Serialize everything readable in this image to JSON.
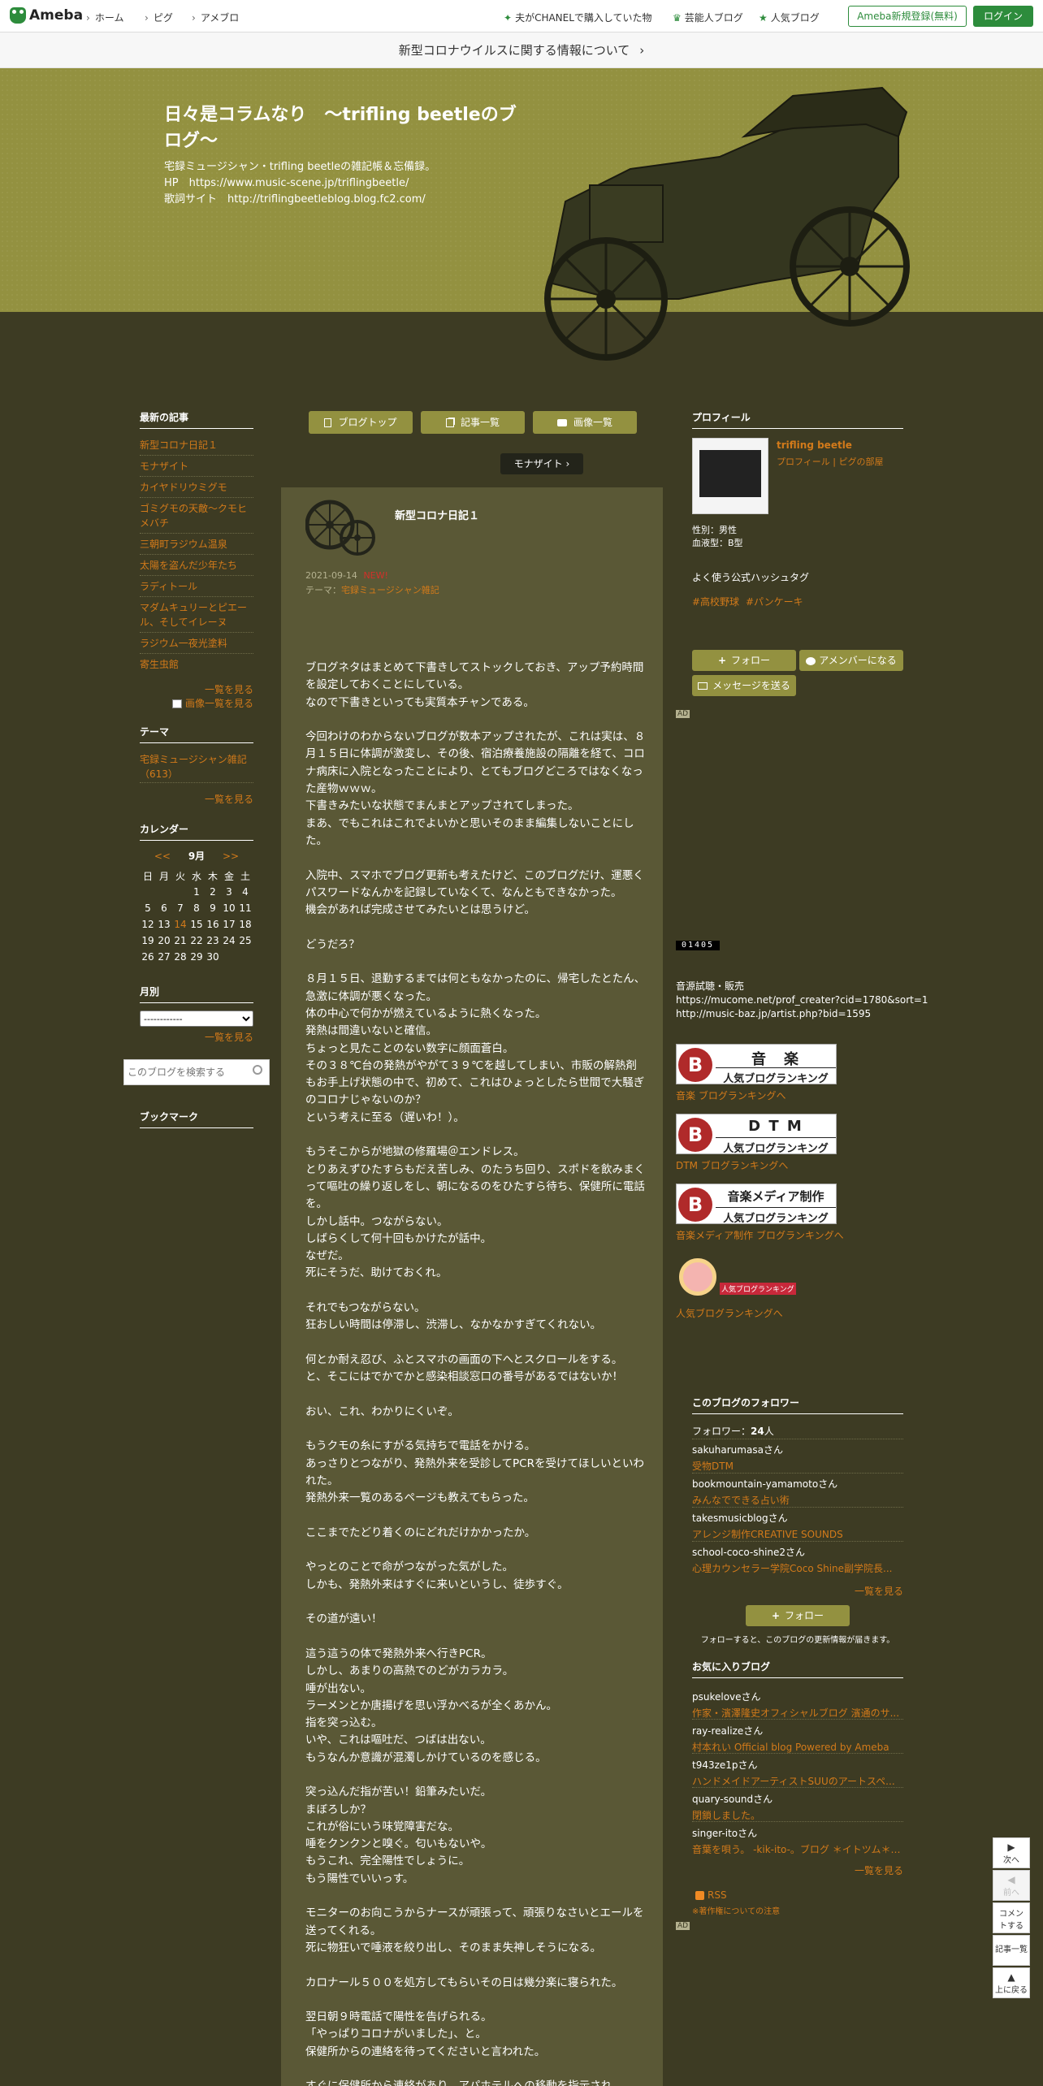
{
  "topbar": {
    "logo": "Ameba",
    "nav": [
      "ホーム",
      "ピグ",
      "アメブロ"
    ],
    "links": [
      "夫がCHANELで購入していた物",
      "芸能人ブログ",
      "人気ブログ"
    ],
    "register": "Ameba新規登録(無料)",
    "login": "ログイン"
  },
  "notice": "新型コロナウイルスに関する情報について",
  "blog": {
    "title": "日々是コラムなり　～trifling beetleのブログ～",
    "description": "宅録ミュージシャン・trifling beetleの雑記帳＆忘備録。\nHP　https://www.music-scene.jp/triflingbeetle/\n歌詞サイト　http://triflingbeetleblog.blog.fc2.com/"
  },
  "tabs": {
    "top": "ブログトップ",
    "list": "記事一覧",
    "images": "画像一覧"
  },
  "next_post": "モナザイト",
  "post": {
    "title": "新型コロナ日記１",
    "date": "2021-09-14",
    "badge": "NEW!",
    "theme_label": "テーマ：",
    "theme": "宅録ミュージシャン雑記",
    "body": "ブログネタはまとめて下書きしてストックしておき、アップ予約時間を設定しておくことにしている。\nなので下書きといっても実質本チャンである。\n\n今回わけのわからないブログが数本アップされたが、これは実は、８月１５日に体調が激変し、その後、宿泊療養施設の隔離を経て、コロナ病床に入院となったことにより、とてもブログどころではなくなった産物ｗｗｗ。\n下書きみたいな状態でまんまとアップされてしまった。\nまあ、でもこれはこれでよいかと思いそのまま編集しないことにした。\n\n入院中、スマホでブログ更新も考えたけど、このブログだけ、運悪くパスワードなんかを記録していなくて、なんともできなかった。\n機会があれば完成させてみたいとは思うけど。\n\nどうだろ？\n\n８月１５日、退勤するまでは何ともなかったのに、帰宅したとたん、急激に体調が悪くなった。\n体の中心で何かが燃えているように熱くなった。\n発熱は間違いないと確信。\nちょっと見たことのない数字に顔面蒼白。\nその３８℃台の発熱がやがて３９℃を越してしまい、市販の解熱剤もお手上げ状態の中で、初めて、これはひょっとしたら世間で大騒ぎのコロナじゃないのか？\nという考えに至る（遅いわ！）。\n\nもうそこからが地獄の修羅場＠エンドレス。\nとりあえずひたすらもだえ苦しみ、のたうち回り、スポドを飲みまくって嘔吐の繰り返しをし、朝になるのをひたすら待ち、保健所に電話を。\nしかし話中。つながらない。\nしばらくして何十回もかけたが話中。\nなぜだ。\n死にそうだ、助けておくれ。\n\nそれでもつながらない。\n狂おしい時間は停滞し、渋滞し、なかなかすぎてくれない。\n\n何とか耐え忍び、ふとスマホの画面の下へとスクロールをする。\nと、そこにはでかでかと感染相談窓口の番号があるではないか！\n\nおい、これ、わかりにくいぞ。\n\nもうクモの糸にすがる気持ちで電話をかける。\nあっさりとつながり、発熱外来を受診してPCRを受けてほしいといわれた。\n発熱外来一覧のあるページも教えてもらった。\n\nここまでたどり着くのにどれだけかかったか。\n\nやっとのことで命がつながった気がした。\nしかも、発熱外来はすぐに来いというし、徒歩すぐ。\n\nその道が遠い！\n\n這う這うの体で発熱外来へ行きPCR。\nしかし、あまりの高熱でのどがカラカラ。\n唾が出ない。\nラーメンとか唐揚げを思い浮かべるが全くあかん。\n指を突っ込む。\nいや、これは嘔吐だ、つばは出ない。\nもうなんか意識が混濁しかけているのを感じる。\n\n突っ込んだ指が苦い！鉛筆みたいだ。\nまぼろしか？\nこれが俗にいう味覚障害だな。\n唾をクンクンと嗅ぐ。匂いもないや。\nもうこれ、完全陽性でしょうに。\nもう陽性でいいっす。\n\nモニターのお向こうからナースが頑張って、頑張りなさいとエールを送ってくれる。\n死に物狂いで唾液を絞り出し、そのまま失神しそうになる。\n\nカロナール５００を処方してもらいその日は幾分楽に寝られた。\n\n翌日朝９時電話で陽性を告げられる。\n「やっぱりコロナがいました」、と。\n保健所からの連絡を待ってくださいと言われた。\n\nすぐに保健所から連絡があり、アパホテルへの移動を指示され"
  },
  "sidebar": {
    "recent_title": "最新の記事",
    "recent": [
      "新型コロナ日記１",
      "モナザイト",
      "カイヤドリウミグモ",
      "ゴミグモの天敵～クモヒメバチ",
      "三朝町ラジウム温泉",
      "太陽を盗んだ少年たち",
      "ラディトール",
      "マダムキュリーとピエール、そしてイレーヌ",
      "ラジウム一夜光塗料",
      "寄生虫館"
    ],
    "more": "一覧を見る",
    "images_more": "画像一覧を見る",
    "theme_title": "テーマ",
    "theme_item": "宅録ミュージシャン雑記（613）",
    "calendar_title": "カレンダー",
    "cal_prev": "<<",
    "cal_month": "9月",
    "cal_next": ">>",
    "weekdays": [
      "日",
      "月",
      "火",
      "水",
      "木",
      "金",
      "土"
    ],
    "weeks": [
      [
        "",
        "",
        "",
        "1",
        "2",
        "3",
        "4"
      ],
      [
        "5",
        "6",
        "7",
        "8",
        "9",
        "10",
        "11"
      ],
      [
        "12",
        "13",
        "14",
        "15",
        "16",
        "17",
        "18"
      ],
      [
        "19",
        "20",
        "21",
        "22",
        "23",
        "24",
        "25"
      ],
      [
        "26",
        "27",
        "28",
        "29",
        "30",
        "",
        ""
      ]
    ],
    "today": "14",
    "month_title": "月別",
    "month_select": "------------",
    "search_placeholder": "このブログを検索する",
    "bookmark_title": "ブックマーク"
  },
  "profile": {
    "title": "プロフィール",
    "name": "trifling beetle",
    "links": "プロフィール | ピグの部屋",
    "gender": "性別：男性",
    "blood": "血液型：B型",
    "hashtag_title": "よく使う公式ハッシュタグ",
    "hashtags": [
      "#高校野球",
      "#パンケーキ"
    ],
    "follow": "フォロー",
    "member": "アメンバーになる",
    "message": "メッセージを送る",
    "ad": "AD"
  },
  "widgets": {
    "counter": "01405",
    "audio_label": "音源試聴・販売",
    "audio_url1": "https://mucome.net/prof_creater?cid=1780&sort=1",
    "audio_url2": "http://music-baz.jp/artist.php?bid=1595",
    "ranks": [
      {
        "t1": "音　楽",
        "t2": "人気ブログランキング",
        "link": "音楽 ブログランキングへ"
      },
      {
        "t1": "D T M",
        "t2": "人気ブログランキング",
        "link": "DTM ブログランキングへ"
      },
      {
        "t1": "音楽メディア制作",
        "t2": "人気ブログランキング",
        "link": "音楽メディア制作 ブログランキングへ"
      }
    ],
    "roll_label": "人気ブログランキング",
    "roll_link": "人気ブログランキングへ"
  },
  "followers": {
    "title": "このブログのフォロワー",
    "count_label": "フォロワー：",
    "count": "24",
    "unit": "人",
    "items": [
      {
        "name": "sakuharumasaさん",
        "blog": "受物DTM"
      },
      {
        "name": "bookmountain-yamamotoさん",
        "blog": "みんなでできる占い術"
      },
      {
        "name": "takesmusicblogさん",
        "blog": "アレンジ制作CREATIVE SOUNDS"
      },
      {
        "name": "school-coco-shine2さん",
        "blog": "心理カウンセラー学院Coco Shine副学院長..."
      }
    ],
    "more": "一覧を見る",
    "follow": "フォロー",
    "note": "フォローすると、このブログの更新情報が届きます。"
  },
  "favorites": {
    "title": "お気に入りブログ",
    "items": [
      {
        "name": "psukeloveさん",
        "blog": "作家・濱澤隆史オフィシャルブログ 濱通のサ..."
      },
      {
        "name": "ray-realizeさん",
        "blog": "村本れい Official blog Powered by Ameba"
      },
      {
        "name": "t943ze1pさん",
        "blog": "ハンドメイドアーティストSUUのアートスペ..."
      },
      {
        "name": "quary-soundさん",
        "blog": "閉鎖しました。"
      },
      {
        "name": "singer-itoさん",
        "blog": "音葉を唄う。 -kik-ito-。ブログ ＊イトツム＊唄＊"
      }
    ],
    "more": "一覧を見る",
    "rss": "RSS",
    "rss_note": "※著作権についての注意",
    "ad": "AD"
  },
  "sidectl": {
    "next": "次へ",
    "prev": "前へ",
    "comment": "コメントする",
    "list": "記事一覧",
    "top": "上に戻る"
  }
}
